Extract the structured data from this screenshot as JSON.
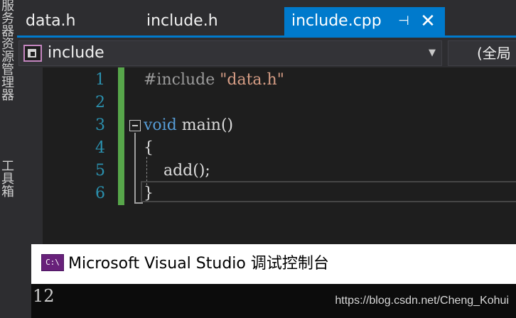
{
  "side_panel": {
    "label_top": "服务器资源管理器",
    "label_bottom": "工具箱"
  },
  "tabs": [
    {
      "label": "data.h"
    },
    {
      "label": "include.h"
    },
    {
      "label": "include.cpp",
      "active": true
    }
  ],
  "tab_controls": {
    "pin_glyph": "⊣",
    "close_glyph": "✕"
  },
  "navigation": {
    "scope": "include",
    "dropdown_glyph": "▼",
    "member": "(全局"
  },
  "editor": {
    "line_numbers": [
      "1",
      "2",
      "3",
      "4",
      "5",
      "6"
    ],
    "lines": {
      "l1_directive": "#include ",
      "l1_string": "\"data.h\"",
      "l3_keyword": "void",
      "l3_rest": " main()",
      "l4": "{",
      "l5": "    add();",
      "l6": "}"
    }
  },
  "console": {
    "icon_label": "C:\\",
    "title": "Microsoft Visual Studio 调试控制台",
    "output": "12"
  },
  "watermark": "https://blog.csdn.net/Cheng_Kohui",
  "colors": {
    "accent": "#007acc",
    "editor_bg": "#1e1e1e",
    "chrome_bg": "#2d2d30",
    "line_number": "#2b91af",
    "keyword": "#569cd6",
    "string": "#d69d85",
    "change_bar": "#57a64a"
  }
}
